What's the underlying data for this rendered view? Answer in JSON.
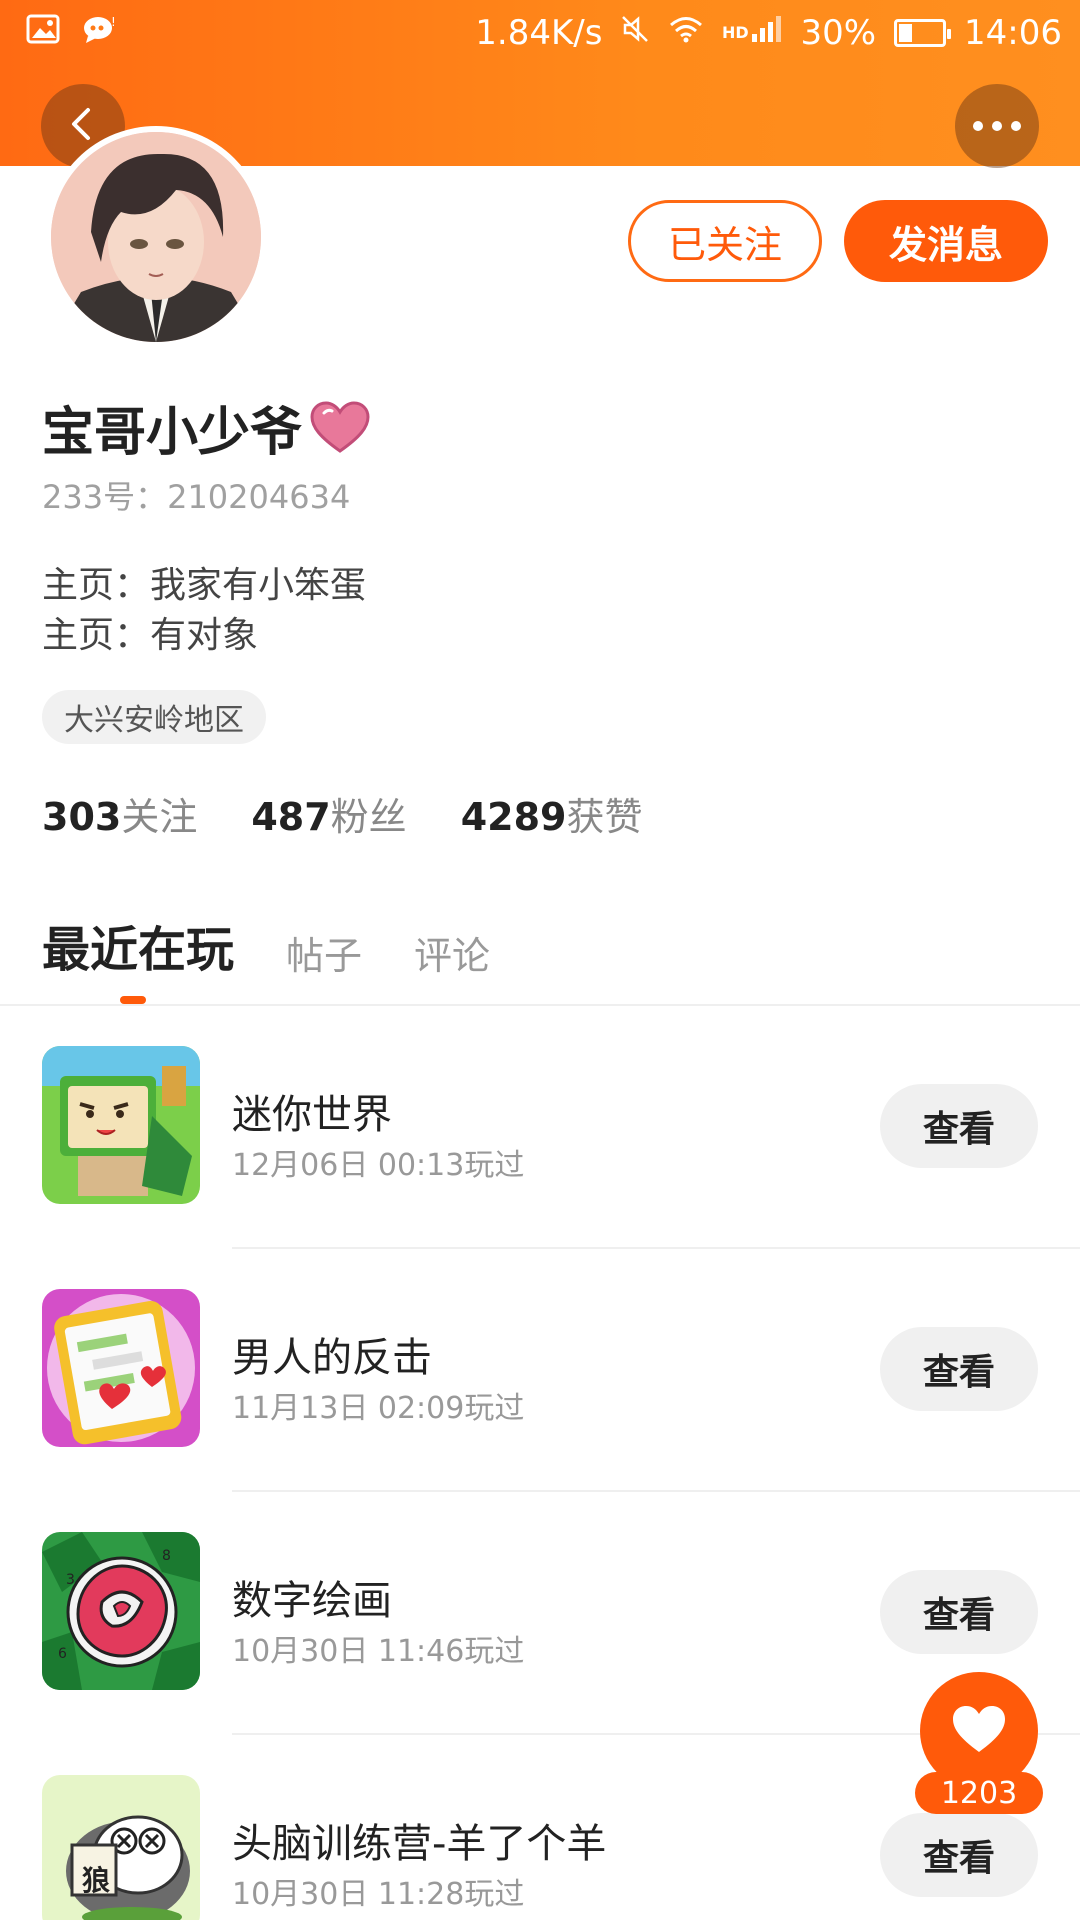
{
  "status_bar": {
    "net_speed": "1.84K/s",
    "battery_percent": "30%",
    "battery_level": 0.3,
    "time": "14:06",
    "icons": [
      "gallery-icon",
      "chat-bubble-icon",
      "mute-icon",
      "wifi-icon",
      "hd-icon",
      "signal-icon",
      "battery-icon"
    ]
  },
  "header": {
    "back_icon": "back-chevron-icon",
    "more_icon": "more-dots-icon",
    "accent_color": "#ff6a13"
  },
  "profile": {
    "followed_label": "已关注",
    "message_label": "发消息",
    "username": "宝哥小少爷",
    "id_label": "233号：210204634",
    "bio_lines": [
      "主页：我家有小笨蛋",
      "主页：有对象"
    ],
    "region": "大兴安岭地区",
    "stats": [
      {
        "num": "303",
        "label": "关注"
      },
      {
        "num": "487",
        "label": "粉丝"
      },
      {
        "num": "4289",
        "label": "获赞"
      }
    ]
  },
  "tabs": [
    {
      "label": "最近在玩",
      "active": true
    },
    {
      "label": "帖子",
      "active": false
    },
    {
      "label": "评论",
      "active": false
    }
  ],
  "games": [
    {
      "name": "迷你世界",
      "time": "12月06日 00:13玩过",
      "button": "查看"
    },
    {
      "name": "男人的反击",
      "time": "11月13日 02:09玩过",
      "button": "查看"
    },
    {
      "name": "数字绘画",
      "time": "10月30日 11:46玩过",
      "button": "查看"
    },
    {
      "name": "头脑训练营-羊了个羊",
      "time": "10月30日 11:28玩过",
      "button": "查看"
    }
  ],
  "floating_like": {
    "count": "1203",
    "icon": "heart-icon"
  },
  "game4_icon_text": "狼"
}
